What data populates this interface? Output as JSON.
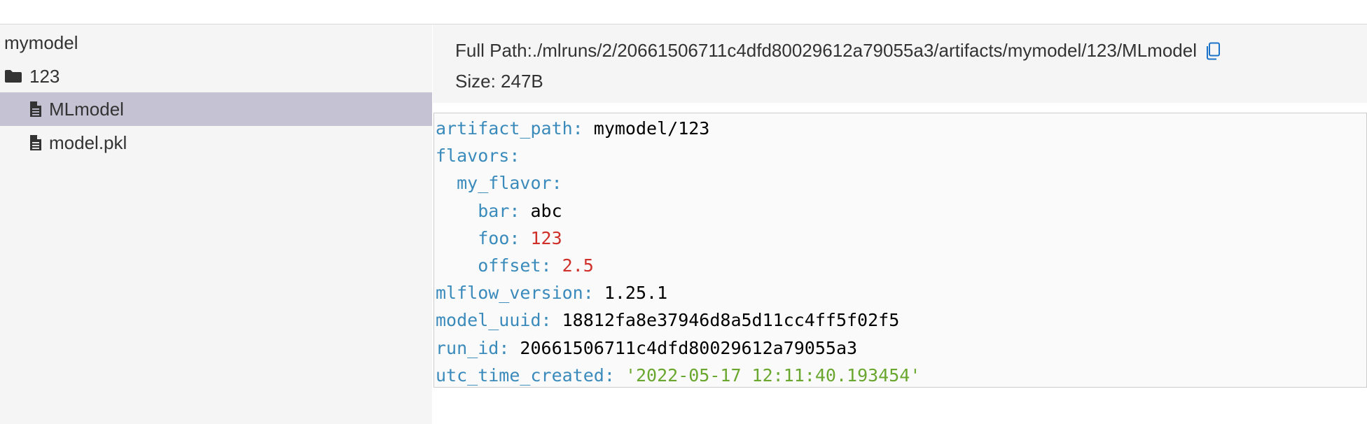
{
  "sidebar": {
    "root_label": "mymodel",
    "folder_label": "123",
    "files": [
      {
        "label": "MLmodel"
      },
      {
        "label": "model.pkl"
      }
    ]
  },
  "info": {
    "full_path_label": "Full Path:",
    "full_path_value": "./mlruns/2/20661506711c4dfd80029612a79055a3/artifacts/mymodel/123/MLmodel",
    "size_label": "Size: 247B"
  },
  "yaml": {
    "artifact_path": {
      "key": "artifact_path",
      "value": "mymodel/123"
    },
    "flavors": {
      "key": "flavors"
    },
    "my_flavor": {
      "key": "my_flavor"
    },
    "bar": {
      "key": "bar",
      "value": "abc"
    },
    "foo": {
      "key": "foo",
      "value": "123"
    },
    "offset": {
      "key": "offset",
      "value": "2.5"
    },
    "mlflow_version": {
      "key": "mlflow_version",
      "value": "1.25.1"
    },
    "model_uuid": {
      "key": "model_uuid",
      "value": "18812fa8e37946d8a5d11cc4ff5f02f5"
    },
    "run_id": {
      "key": "run_id",
      "value": "20661506711c4dfd80029612a79055a3"
    },
    "utc_time_created": {
      "key": "utc_time_created",
      "value": "'2022-05-17 12:11:40.193454'"
    }
  },
  "colors": {
    "yaml_key": "#3a8bbb",
    "yaml_string": "#6aa72f",
    "yaml_number": "#d0302a",
    "selected_row": "#c5c2d3",
    "panel_bg": "#f5f5f5",
    "copy_icon": "#1a73c8"
  },
  "icons": {
    "folder": "folder-icon",
    "file": "file-icon",
    "copy": "copy-icon"
  }
}
